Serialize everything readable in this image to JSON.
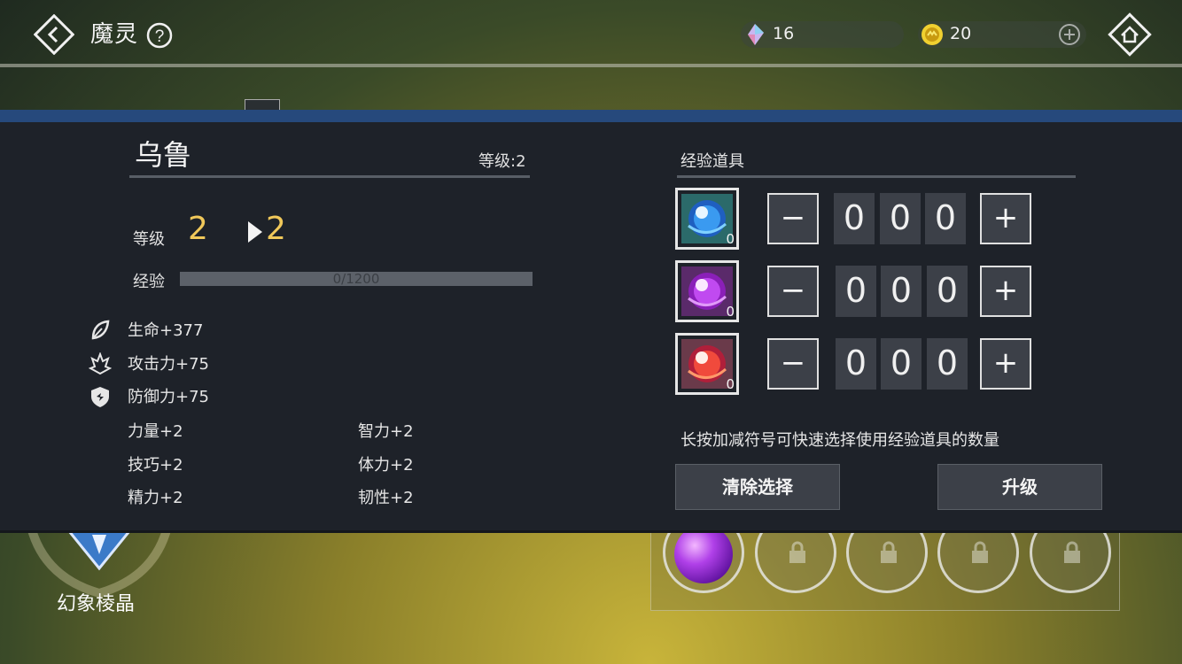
{
  "topbar": {
    "title": "魔灵",
    "crystal": "16",
    "coin": "20"
  },
  "background": {
    "crest_label": "幻象棱晶"
  },
  "modal": {
    "name": "乌鲁",
    "level_small": "等级:2",
    "level_label": "等级",
    "level_current": "2",
    "level_next": "2",
    "exp_label": "经验",
    "exp_text": "0/1200",
    "exp_progress": 0,
    "stats": [
      {
        "icon": "leaf-icon",
        "text": "生命+377"
      },
      {
        "icon": "fire-icon",
        "text": "攻击力+75"
      },
      {
        "icon": "shield-icon",
        "text": "防御力+75"
      }
    ],
    "attributes": [
      {
        "left": "力量+2",
        "right": "智力+2"
      },
      {
        "left": "技巧+2",
        "right": "体力+2"
      },
      {
        "left": "精力+2",
        "right": "韧性+2"
      }
    ],
    "exp_items_title": "经验道具",
    "exp_items": [
      {
        "color": "#3a8ee8",
        "count": "0",
        "digits": [
          "0",
          "0",
          "0"
        ]
      },
      {
        "color": "#b23ee0",
        "count": "0",
        "digits": [
          "0",
          "0",
          "0"
        ]
      },
      {
        "color": "#e84b3c",
        "count": "0",
        "digits": [
          "0",
          "0",
          "0"
        ]
      }
    ],
    "minus_label": "−",
    "plus_label": "+",
    "hint": "长按加减符号可快速选择使用经验道具的数量",
    "clear_button": "清除选择",
    "upgrade_button": "升级"
  }
}
